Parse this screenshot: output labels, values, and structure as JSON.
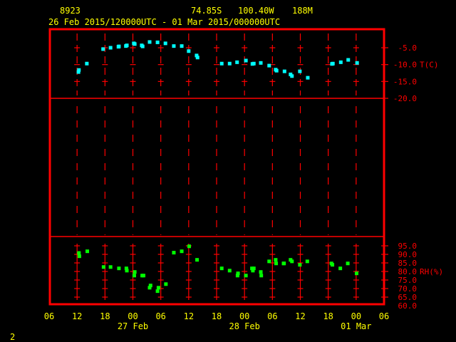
{
  "header": {
    "station_id": "8923",
    "latitude": "74.85S",
    "longitude": "100.40W",
    "elevation": "188M",
    "time_range": "26 Feb 2015/120000UTC - 01 Mar 2015/000000UTC"
  },
  "page_number": "2",
  "colors": {
    "frame": "#ff0000",
    "text": "#ffff00",
    "temperature": "#00ffff",
    "rh": "#00ff00"
  },
  "chart_data": [
    {
      "type": "scatter",
      "title": "Temperature",
      "ylabel": "T(C)",
      "x_units": "hours since 26 Feb 06UTC",
      "xlim": [
        0,
        72
      ],
      "ylim": [
        -20,
        0.5
      ],
      "yticks": [
        "-5.0",
        "-10.0",
        "-15.0",
        "-20.0"
      ],
      "ytick_values": [
        -5,
        -10,
        -15,
        -20
      ],
      "x": [
        6.3,
        6.4,
        8.1,
        11.6,
        13.2,
        14.9,
        15.0,
        16.5,
        16.7,
        18.2,
        18.4,
        19.9,
        20.1,
        21.6,
        23.3,
        25.0,
        26.8,
        28.5,
        30.0,
        31.7,
        31.9,
        37.1,
        38.8,
        40.4,
        42.3,
        43.7,
        44.0,
        45.5,
        47.3,
        48.7,
        48.9,
        50.6,
        51.9,
        52.2,
        53.9,
        55.6,
        60.8,
        61.0,
        62.7,
        64.3,
        66.2
      ],
      "y": [
        -12.2,
        -11.6,
        -9.7,
        -5.4,
        -5.0,
        -4.7,
        -4.6,
        -4.5,
        -4.3,
        -3.7,
        -3.9,
        -4.3,
        -4.6,
        -3.3,
        -3.4,
        -3.7,
        -4.5,
        -4.5,
        -6.0,
        -7.3,
        -7.9,
        -9.7,
        -9.7,
        -9.3,
        -8.8,
        -9.8,
        -9.7,
        -9.5,
        -10.3,
        -11.5,
        -11.8,
        -12.0,
        -12.9,
        -13.4,
        -12.0,
        -13.9,
        -9.8,
        -9.7,
        -9.3,
        -8.6,
        -9.5
      ]
    },
    {
      "type": "scatter",
      "title": "Relative Humidity",
      "ylabel": "RH(%)",
      "x_units": "hours since 26 Feb 06UTC",
      "xlim": [
        0,
        72
      ],
      "ylim": [
        60,
        100
      ],
      "yticks": [
        "95.0",
        "90.0",
        "85.0",
        "80.0",
        "75.0",
        "70.0",
        "65.0",
        "60.0"
      ],
      "ytick_values": [
        95,
        90,
        85,
        80,
        75,
        70,
        65,
        60
      ],
      "x": [
        6.4,
        6.5,
        8.2,
        11.7,
        13.2,
        15.0,
        16.6,
        16.7,
        18.4,
        18.3,
        20.0,
        20.3,
        21.8,
        21.6,
        23.5,
        23.3,
        25.1,
        26.8,
        28.5,
        30.1,
        31.8,
        37.1,
        38.8,
        40.6,
        40.5,
        42.3,
        43.6,
        44.0,
        43.8,
        45.5,
        45.6,
        47.3,
        48.7,
        48.8,
        50.4,
        50.5,
        51.9,
        52.2,
        53.9,
        55.5,
        60.7,
        60.9,
        62.6,
        64.2,
        66.1
      ],
      "y": [
        90.8,
        88.9,
        91.8,
        82.6,
        82.6,
        81.8,
        81.8,
        80.5,
        79.7,
        77.6,
        77.6,
        77.6,
        71.8,
        70.5,
        70.5,
        68.5,
        72.6,
        91.0,
        91.8,
        94.7,
        86.8,
        81.8,
        80.5,
        78.9,
        77.6,
        77.6,
        81.8,
        81.8,
        80.5,
        79.7,
        77.6,
        85.9,
        86.8,
        84.7,
        84.7,
        84.7,
        86.8,
        85.9,
        83.9,
        85.9,
        84.7,
        83.9,
        81.8,
        84.7,
        78.9
      ]
    }
  ],
  "x_axis": {
    "tick_hours": [
      0,
      6,
      12,
      18,
      24,
      30,
      36,
      42,
      48,
      54,
      60,
      66,
      72
    ],
    "tick_labels": [
      "06",
      "12",
      "18",
      "00",
      "06",
      "12",
      "18",
      "00",
      "06",
      "12",
      "18",
      "00",
      "06"
    ],
    "date_labels": [
      {
        "label": "27 Feb",
        "hour": 18
      },
      {
        "label": "28 Feb",
        "hour": 42
      },
      {
        "label": "01 Mar",
        "hour": 66
      }
    ]
  }
}
